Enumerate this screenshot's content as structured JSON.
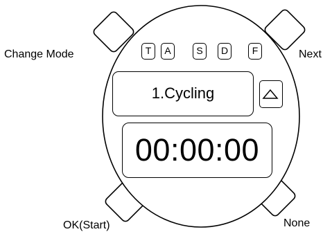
{
  "buttons": {
    "top_left": {
      "label": "Change Mode"
    },
    "top_right": {
      "label": "Next"
    },
    "bottom_left": {
      "label": "OK(Start)"
    },
    "bottom_right": {
      "label": "None"
    }
  },
  "mode_keys": [
    "T",
    "A",
    "S",
    "D",
    "F"
  ],
  "display": {
    "activity": "1.Cycling",
    "timer": "00:00:00",
    "scroll_icon": "triangle-up-icon"
  }
}
